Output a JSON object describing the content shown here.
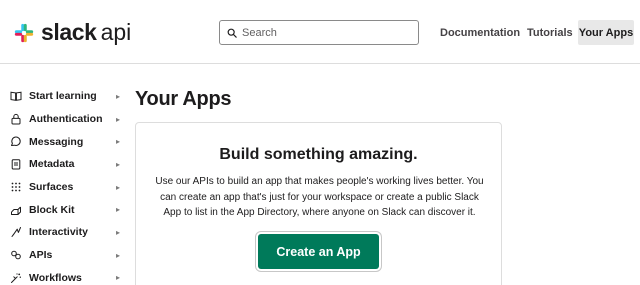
{
  "header": {
    "logo_word": "slack",
    "logo_suffix": "api",
    "search": {
      "placeholder": "Search",
      "value": ""
    },
    "nav": {
      "documentation": "Documentation",
      "tutorials": "Tutorials",
      "your_apps": "Your Apps"
    }
  },
  "sidebar": {
    "items": [
      {
        "label": "Start learning",
        "icon": "book-icon",
        "arrow": "▸"
      },
      {
        "label": "Authentication",
        "icon": "lock-icon",
        "arrow": "▸"
      },
      {
        "label": "Messaging",
        "icon": "message-icon",
        "arrow": "▸"
      },
      {
        "label": "Metadata",
        "icon": "clipboard-icon",
        "arrow": "▸"
      },
      {
        "label": "Surfaces",
        "icon": "grid-dots-icon",
        "arrow": "▸"
      },
      {
        "label": "Block Kit",
        "icon": "blocks-icon",
        "arrow": "▸"
      },
      {
        "label": "Interactivity",
        "icon": "cursor-spark-icon",
        "arrow": "▸"
      },
      {
        "label": "APIs",
        "icon": "link-icon",
        "arrow": "▸"
      },
      {
        "label": "Workflows",
        "icon": "workflow-icon",
        "arrow": "▸"
      }
    ]
  },
  "main": {
    "title": "Your Apps",
    "card": {
      "title": "Build something amazing.",
      "body": "Use our APIs to build an app that makes people's working lives better. You can create an app that's just for your workspace or create a public Slack App to list in the App Directory, where anyone on Slack can discover it.",
      "button_label": "Create an App"
    }
  },
  "colors": {
    "brand_green": "#007a5a",
    "active_nav_bg": "#e8e8e8",
    "border": "#dddddd"
  }
}
